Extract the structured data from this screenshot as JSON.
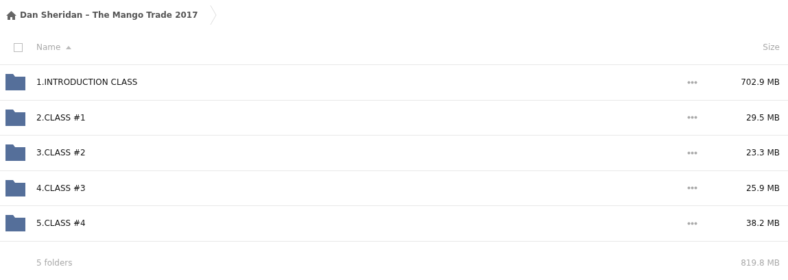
{
  "breadcrumb": {
    "title": "Dan Sheridan – The Mango Trade 2017"
  },
  "header": {
    "select_all": {
      "checked": false
    },
    "name_column": "Name",
    "size_column": "Size",
    "sort_ascending": true
  },
  "rows": [
    {
      "name": "1.INTRODUCTION CLASS",
      "size": "702.9 MB",
      "kind": "folder"
    },
    {
      "name": "2.CLASS #1",
      "size": "29.5 MB",
      "kind": "folder"
    },
    {
      "name": "3.CLASS #2",
      "size": "23.3 MB",
      "kind": "folder"
    },
    {
      "name": "4.CLASS #3",
      "size": "25.9 MB",
      "kind": "folder"
    },
    {
      "name": "5.CLASS #4",
      "size": "38.2 MB",
      "kind": "folder"
    }
  ],
  "footer": {
    "count": "5 folders",
    "total": "819.8 MB"
  }
}
